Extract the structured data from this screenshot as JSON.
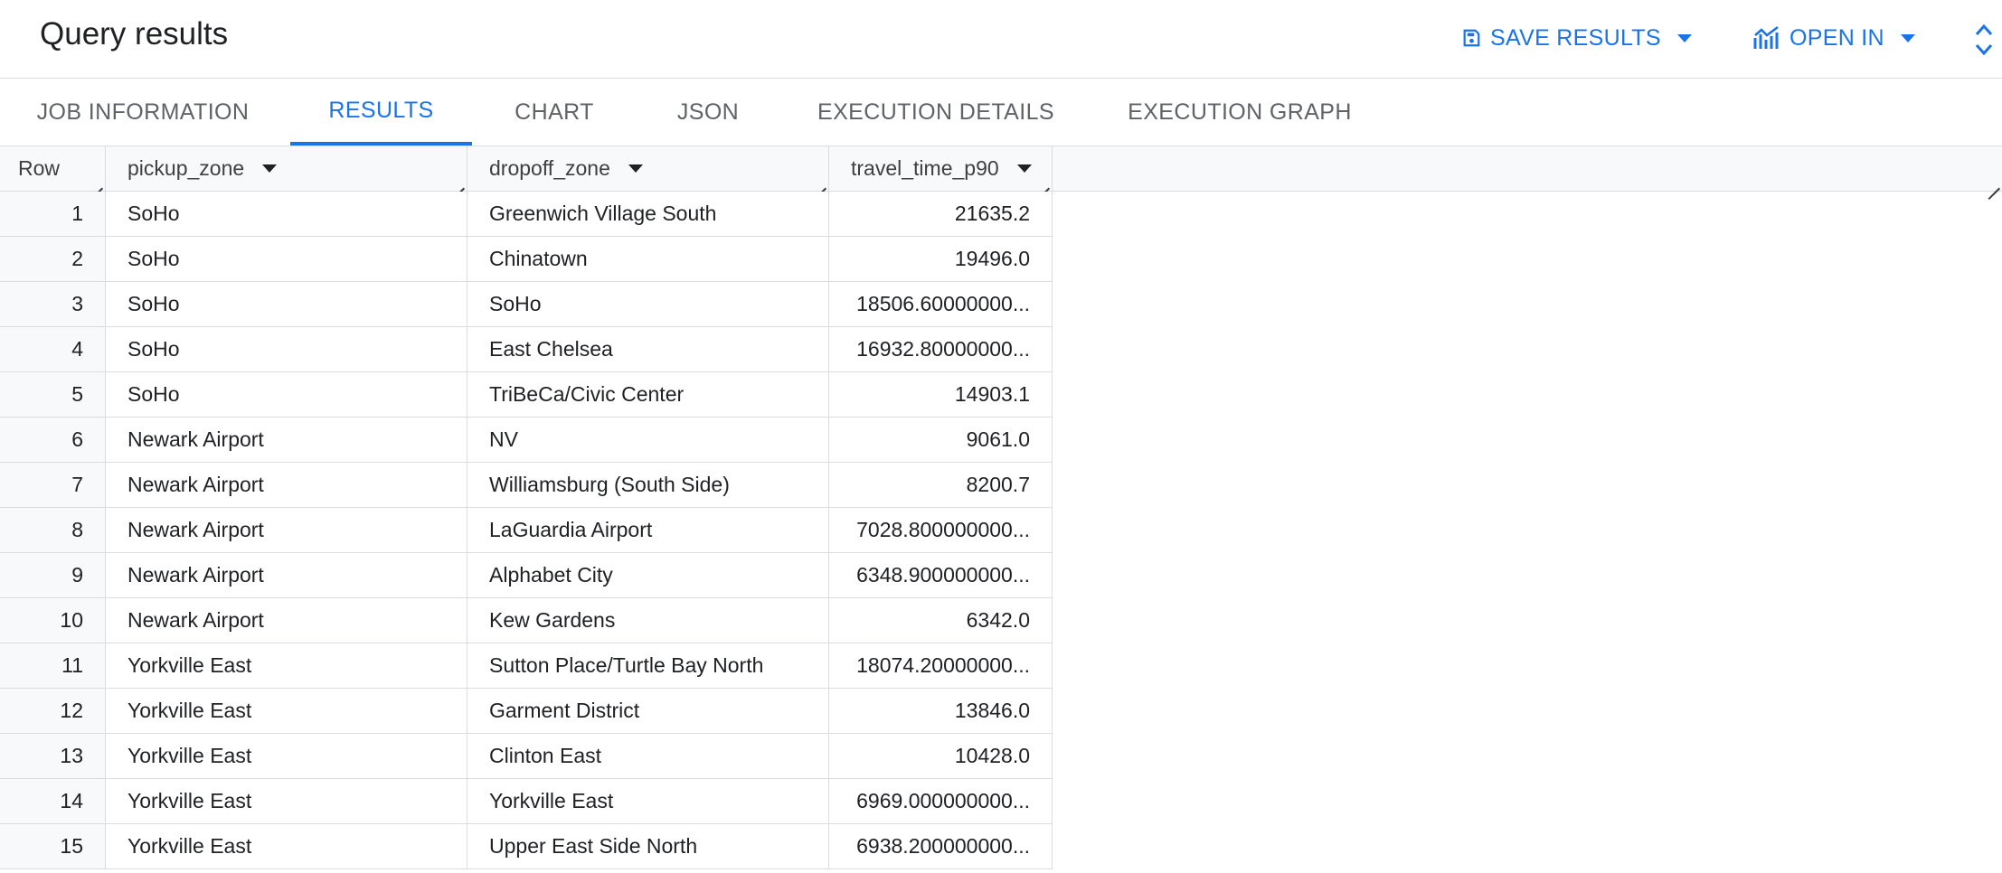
{
  "header": {
    "title": "Query results",
    "save_results_label": "SAVE RESULTS",
    "open_in_label": "OPEN IN",
    "accent_color": "#1a73e8"
  },
  "tabs": [
    {
      "label": "JOB INFORMATION",
      "active": false
    },
    {
      "label": "RESULTS",
      "active": true
    },
    {
      "label": "CHART",
      "active": false
    },
    {
      "label": "JSON",
      "active": false
    },
    {
      "label": "EXECUTION DETAILS",
      "active": false
    },
    {
      "label": "EXECUTION GRAPH",
      "active": false
    }
  ],
  "table": {
    "columns": [
      "Row",
      "pickup_zone",
      "dropoff_zone",
      "travel_time_p90"
    ],
    "rows": [
      {
        "row": "1",
        "pickup_zone": "SoHo",
        "dropoff_zone": "Greenwich Village South",
        "travel_time_p90": "21635.2"
      },
      {
        "row": "2",
        "pickup_zone": "SoHo",
        "dropoff_zone": "Chinatown",
        "travel_time_p90": "19496.0"
      },
      {
        "row": "3",
        "pickup_zone": "SoHo",
        "dropoff_zone": "SoHo",
        "travel_time_p90": "18506.60000000..."
      },
      {
        "row": "4",
        "pickup_zone": "SoHo",
        "dropoff_zone": "East Chelsea",
        "travel_time_p90": "16932.80000000..."
      },
      {
        "row": "5",
        "pickup_zone": "SoHo",
        "dropoff_zone": "TriBeCa/Civic Center",
        "travel_time_p90": "14903.1"
      },
      {
        "row": "6",
        "pickup_zone": "Newark Airport",
        "dropoff_zone": "NV",
        "travel_time_p90": "9061.0"
      },
      {
        "row": "7",
        "pickup_zone": "Newark Airport",
        "dropoff_zone": "Williamsburg (South Side)",
        "travel_time_p90": "8200.7"
      },
      {
        "row": "8",
        "pickup_zone": "Newark Airport",
        "dropoff_zone": "LaGuardia Airport",
        "travel_time_p90": "7028.800000000..."
      },
      {
        "row": "9",
        "pickup_zone": "Newark Airport",
        "dropoff_zone": "Alphabet City",
        "travel_time_p90": "6348.900000000..."
      },
      {
        "row": "10",
        "pickup_zone": "Newark Airport",
        "dropoff_zone": "Kew Gardens",
        "travel_time_p90": "6342.0"
      },
      {
        "row": "11",
        "pickup_zone": "Yorkville East",
        "dropoff_zone": "Sutton Place/Turtle Bay North",
        "travel_time_p90": "18074.20000000..."
      },
      {
        "row": "12",
        "pickup_zone": "Yorkville East",
        "dropoff_zone": "Garment District",
        "travel_time_p90": "13846.0"
      },
      {
        "row": "13",
        "pickup_zone": "Yorkville East",
        "dropoff_zone": "Clinton East",
        "travel_time_p90": "10428.0"
      },
      {
        "row": "14",
        "pickup_zone": "Yorkville East",
        "dropoff_zone": "Yorkville East",
        "travel_time_p90": "6969.000000000..."
      },
      {
        "row": "15",
        "pickup_zone": "Yorkville East",
        "dropoff_zone": "Upper East Side North",
        "travel_time_p90": "6938.200000000..."
      }
    ]
  }
}
